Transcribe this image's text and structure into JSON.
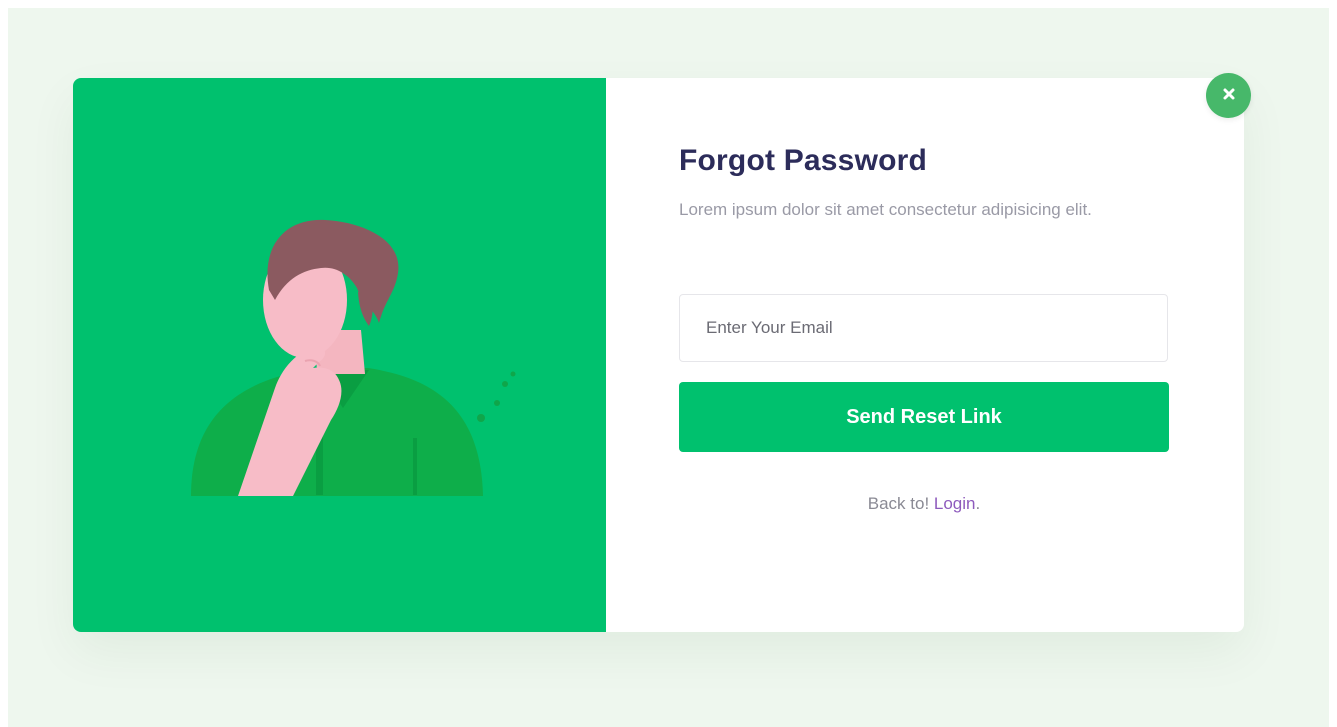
{
  "forgot_password": {
    "title": "Forgot Password",
    "subtitle": "Lorem ipsum dolor sit amet consectetur adipisicing elit.",
    "email_placeholder": "Enter Your Email",
    "email_value": "",
    "submit_label": "Send Reset Link",
    "back_prefix": "Back to! ",
    "login_link_label": "Login",
    "back_suffix": "."
  },
  "icons": {
    "close": "close-icon",
    "illustration": "thinking-person-illustration"
  },
  "colors": {
    "page_background": "#eef7ee",
    "accent_green": "#00c16e",
    "close_button": "#47b86a",
    "title": "#2c2c5a",
    "link": "#8e5bbd",
    "muted_text": "#9a9aa6"
  }
}
